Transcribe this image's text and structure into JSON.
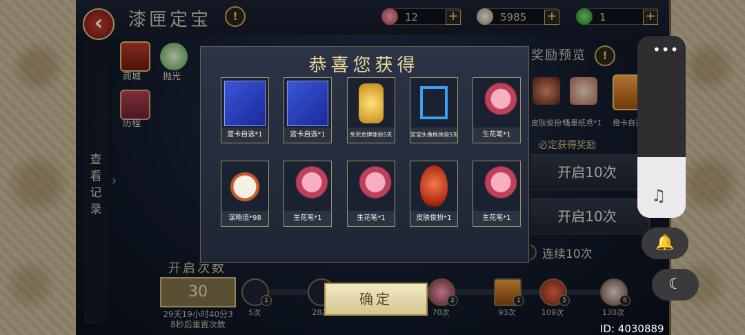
{
  "header": {
    "title": "漆匣定宝",
    "resources": [
      {
        "icon": "flower-brush-icon",
        "value": "12"
      },
      {
        "icon": "feather-token-icon",
        "value": "5985"
      },
      {
        "icon": "jade-orb-icon",
        "value": "1"
      }
    ]
  },
  "menu": {
    "shop": "商城",
    "polish": "抛光",
    "history": "历程",
    "view_records": "查看记录"
  },
  "reward_preview": {
    "title": "奖励预览",
    "items": [
      {
        "label": "皮肤俊扮*1"
      },
      {
        "label": "场景纸鸢*1"
      },
      {
        "label": "橙卡自选"
      }
    ],
    "subtitle": "必定获得奖励",
    "open_10_a": "开启10次",
    "open_10_b": "开启10次",
    "continuous": "连续10次"
  },
  "progress": {
    "label": "开启次数",
    "count": "30",
    "reset_text": "29天19小时40分3\n8秒后重置次数",
    "milestones": [
      {
        "label": "5次",
        "badge": "1"
      },
      {
        "label": "28次",
        "badge": ""
      },
      {
        "label": "70次",
        "badge": "2"
      },
      {
        "label": "93次",
        "badge": "1"
      },
      {
        "label": "109次",
        "badge": "5"
      },
      {
        "label": "130次",
        "badge": "6"
      }
    ]
  },
  "modal": {
    "title": "恭喜您获得",
    "items": [
      {
        "label": "蓝卡自选*1",
        "type": "blue-card"
      },
      {
        "label": "蓝卡自选*1",
        "type": "blue-card"
      },
      {
        "label": "免死金牌体验5天",
        "type": "gold-plaque"
      },
      {
        "label": "定宝头像框体验5天",
        "type": "avatar-frame"
      },
      {
        "label": "生花笔*1",
        "type": "flower-brush"
      },
      {
        "label": "谋略值*98",
        "type": "feather-token"
      },
      {
        "label": "生花笔*1",
        "type": "flower-brush"
      },
      {
        "label": "生花笔*1",
        "type": "flower-brush"
      },
      {
        "label": "皮肤俊扮*1",
        "type": "opera-mask"
      },
      {
        "label": "生花笔*1",
        "type": "flower-brush"
      }
    ],
    "confirm": "确定"
  },
  "system": {
    "menu_dots": "•••",
    "id_text": "ID: 4030889"
  },
  "colors": {
    "gold": "#e9d79a",
    "card_border": "#a49367",
    "modal_bg": "#2a3446"
  }
}
